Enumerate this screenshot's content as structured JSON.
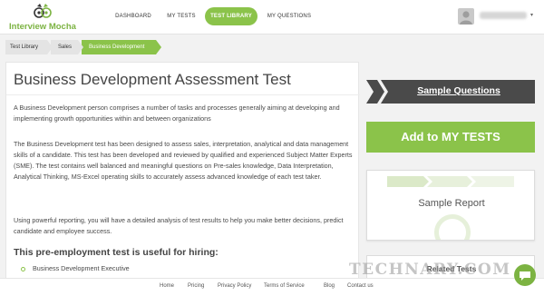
{
  "header": {
    "logo_text": "Interview Mocha",
    "nav": [
      {
        "label": "DASHBOARD",
        "active": false
      },
      {
        "label": "MY TESTS",
        "active": false
      },
      {
        "label": "TEST LIBRARY",
        "active": true
      },
      {
        "label": "MY QUESTIONS",
        "active": false
      }
    ],
    "user": {
      "name": "••••••••••••",
      "caret": "▾"
    }
  },
  "breadcrumb": [
    "Test Library",
    "Sales",
    "Business Development"
  ],
  "main": {
    "title": "Business Development Assessment Test",
    "paragraphs": [
      "A Business Development person comprises a number of tasks and processes generally aiming at developing and implementing growth opportunities within and between organizations",
      "The Business Development test has been designed to assess sales, interpretation, analytical and data management skills of a candidate. This test has been developed and reviewed by qualified and experienced Subject Matter Experts (SME). The test contains well balanced and meaningful questions on Pre-sales knowledge, Data Interpretation, Analytical Thinking, MS-Excel operating skills to accurately assess advanced knowledge of each test taker.",
      "Using powerful reporting, you will have a detailed analysis of test results to help you make better decisions, predict candidate and employee success."
    ],
    "subheading": "This pre-employment test is useful for hiring:",
    "hiring_roles": [
      "Business Development Executive"
    ]
  },
  "sidebar": {
    "sample_questions_label": "Sample Questions",
    "add_button_label": "Add to MY TESTS",
    "sample_report_label": "Sample Report",
    "related_tests_label": "Related Tests"
  },
  "footer": {
    "links": [
      "Home",
      "Pricing",
      "Privacy Policy",
      "Terms of Service",
      "Blog",
      "Contact us"
    ]
  },
  "watermark": "TECHNARY.COM",
  "colors": {
    "brand_green": "#8bc34a",
    "dark_banner": "#4a4a4a",
    "breadcrumb_grey": "#e4e4e4"
  },
  "icons": {
    "logo": "owl-logo-icon",
    "avatar": "user-avatar-icon",
    "chat": "chat-bubble-icon",
    "bullet": "circle-bullet-icon"
  }
}
